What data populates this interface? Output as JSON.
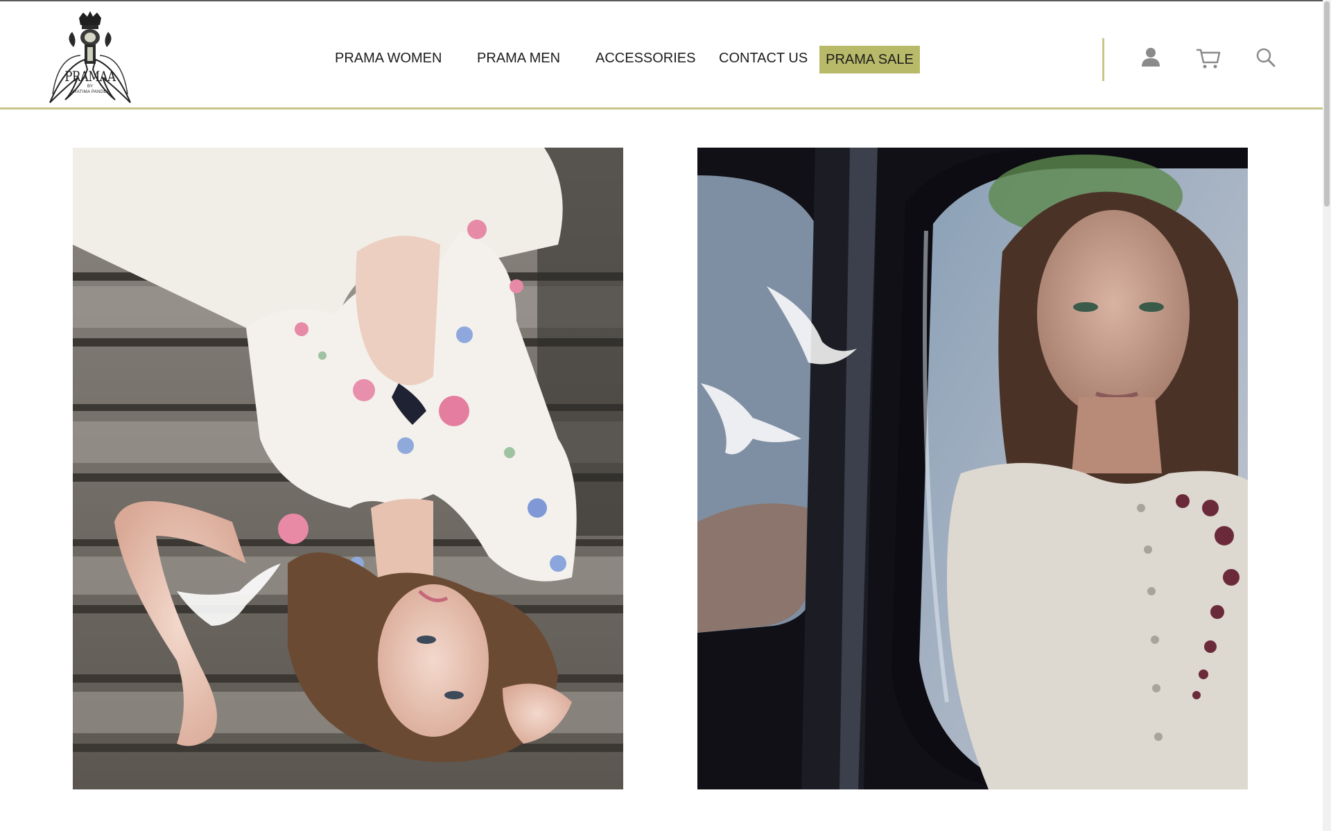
{
  "brand": {
    "logo_text": "PRAMAA",
    "logo_by": "BY",
    "logo_sub": "PRATIMA PANDEY"
  },
  "nav": {
    "items": [
      {
        "label": "PRAMA WOMEN"
      },
      {
        "label": "PRAMA MEN"
      },
      {
        "label": "ACCESSORIES"
      },
      {
        "label": "CONTACT US"
      }
    ],
    "sale_label": "PRAMA SALE"
  },
  "icons": {
    "account": "user-icon",
    "cart": "cart-icon",
    "search": "search-icon"
  },
  "colors": {
    "accent": "#b9b96a",
    "rule": "#c9c58a",
    "text": "#1c1c1c",
    "icon": "#8a8a8a"
  }
}
